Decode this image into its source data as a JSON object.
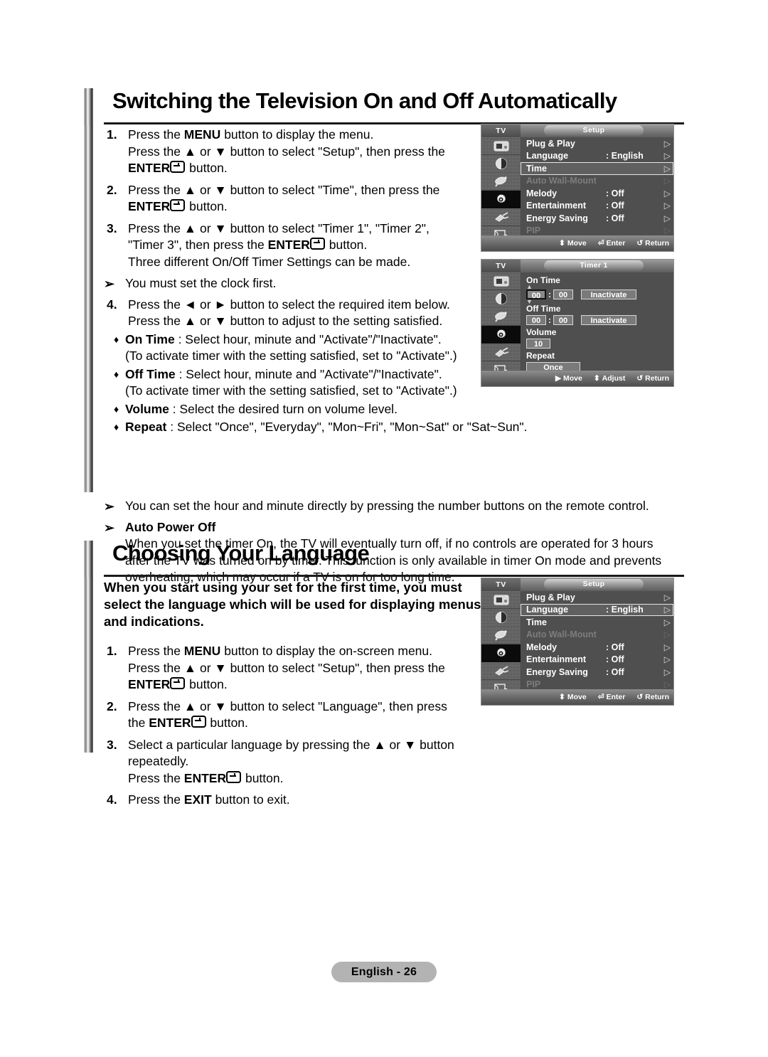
{
  "page": {
    "footer_badge": "English - 26",
    "background": "#ffffff"
  },
  "sections": [
    {
      "heading": "Switching the Television On and Off Automatically",
      "steps": [
        {
          "num": "1.",
          "lines": [
            [
              {
                "t": "Press the "
              },
              {
                "t": "MENU",
                "b": true
              },
              {
                "t": " button to display the menu."
              }
            ],
            [
              {
                "t": "Press the ▲ or ▼ button to select \"Setup\", then press the"
              }
            ],
            [
              {
                "t": "ENTER",
                "b": true
              },
              {
                "icon": "enter-return-icon"
              },
              {
                "t": " button."
              }
            ]
          ]
        },
        {
          "num": "2.",
          "lines": [
            [
              {
                "t": "Press the ▲ or ▼ button to select \"Time\", then press the"
              }
            ],
            [
              {
                "t": "ENTER",
                "b": true
              },
              {
                "icon": "enter-return-icon"
              },
              {
                "t": " button."
              }
            ]
          ]
        },
        {
          "num": "3.",
          "lines": [
            [
              {
                "t": "Press the ▲ or ▼ button to select \"Timer 1\", \"Timer 2\","
              }
            ],
            [
              {
                "t": "\"Timer 3\", then press the "
              },
              {
                "t": "ENTER",
                "b": true
              },
              {
                "icon": "enter-return-icon"
              },
              {
                "t": " button."
              }
            ],
            [
              {
                "t": "Three different On/Off Timer Settings can be made."
              }
            ]
          ]
        }
      ],
      "note_clock": "You must set the clock first.",
      "step4": {
        "num": "4.",
        "lines": [
          [
            {
              "t": "Press the ◄ or ► button to select the required item below."
            }
          ],
          [
            {
              "t": "Press the ▲ or ▼ button to adjust to the setting satisfied."
            }
          ]
        ]
      },
      "bullets": [
        {
          "term": "On Time",
          "rest": " : Select hour, minute and \"Activate\"/\"Inactivate\".",
          "sub": "(To activate timer with the setting satisfied, set to \"Activate\".)"
        },
        {
          "term": "Off Time",
          "rest": " : Select hour, minute and \"Activate\"/\"Inactivate\".",
          "sub": "(To activate timer with the setting satisfied, set to \"Activate\".)"
        },
        {
          "term": "Volume",
          "rest": " : Select the desired turn on volume level.",
          "sub": ""
        },
        {
          "term": "Repeat",
          "rest": " : Select \"Once\", \"Everyday\", \"Mon~Fri\", \"Mon~Sat\" or \"Sat~Sun\".",
          "sub": ""
        }
      ],
      "note_direct": "You can set the hour and minute directly by pressing the number buttons on the remote control.",
      "auto_power": {
        "title": "Auto Power Off",
        "lines": [
          "When you set the timer On, the TV will eventually turn off, if no controls are operated for 3 hours",
          "after the TV was turned on by timer. This function is only available in timer On mode and prevents",
          "overheating, which may occur if a TV is on for too long time."
        ]
      }
    },
    {
      "heading": "Choosing Your Language",
      "intro_lines": [
        "When you start using your set for the first time, you must",
        "select the language which will be used for displaying menus",
        "and indications."
      ],
      "steps": [
        {
          "num": "1.",
          "lines": [
            [
              {
                "t": "Press the "
              },
              {
                "t": "MENU",
                "b": true
              },
              {
                "t": " button to display the on-screen menu."
              }
            ],
            [
              {
                "t": "Press the ▲ or ▼ button to select \"Setup\", then press the"
              }
            ],
            [
              {
                "t": "ENTER",
                "b": true
              },
              {
                "icon": "enter-return-icon"
              },
              {
                "t": " button."
              }
            ]
          ]
        },
        {
          "num": "2.",
          "lines": [
            [
              {
                "t": "Press the ▲ or ▼ button to select \"Language\", then press"
              }
            ],
            [
              {
                "t": "the "
              },
              {
                "t": "ENTER",
                "b": true
              },
              {
                "icon": "enter-return-icon"
              },
              {
                "t": " button."
              }
            ]
          ]
        },
        {
          "num": "3.",
          "lines": [
            [
              {
                "t": "Select a particular language by pressing the ▲ or ▼ button"
              }
            ],
            [
              {
                "t": "repeatedly."
              }
            ],
            [
              {
                "t": "Press the "
              },
              {
                "t": "ENTER",
                "b": true
              },
              {
                "icon": "enter-return-icon"
              },
              {
                "t": " button."
              }
            ]
          ]
        },
        {
          "num": "4.",
          "lines": [
            [
              {
                "t": "Press the "
              },
              {
                "t": "EXIT",
                "b": true
              },
              {
                "t": " button to exit."
              }
            ]
          ]
        }
      ]
    }
  ],
  "osd": {
    "tv_label": "TV",
    "rail_icons": [
      "picture-icon",
      "sound-icon",
      "channel-dish-icon",
      "setup-gear-icon",
      "input-plug-icon",
      "pc-setup-icon"
    ],
    "setup_time": {
      "title": "Setup",
      "rows": [
        {
          "label": "Plug & Play",
          "value": "",
          "state": "normal",
          "arrow": "▷"
        },
        {
          "label": "Language",
          "value": ": English",
          "state": "normal",
          "arrow": "▷"
        },
        {
          "label": "Time",
          "value": "",
          "state": "selected",
          "arrow": "▷"
        },
        {
          "label": "Auto Wall-Mount",
          "value": "",
          "state": "dim",
          "arrow": "▷"
        },
        {
          "label": "Melody",
          "value": ": Off",
          "state": "normal",
          "arrow": "▷"
        },
        {
          "label": "Entertainment",
          "value": ": Off",
          "state": "normal",
          "arrow": "▷"
        },
        {
          "label": "Energy Saving",
          "value": ": Off",
          "state": "normal",
          "arrow": "▷"
        },
        {
          "label": "PIP",
          "value": "",
          "state": "dim",
          "arrow": "▷"
        }
      ],
      "footer": [
        {
          "icon": "updown-arrows-icon",
          "label": "Move"
        },
        {
          "icon": "enter-return-icon",
          "label": "Enter"
        },
        {
          "icon": "return-arrow-icon",
          "label": "Return"
        }
      ]
    },
    "setup_language": {
      "title": "Setup",
      "rows": [
        {
          "label": "Plug & Play",
          "value": "",
          "state": "normal",
          "arrow": "▷"
        },
        {
          "label": "Language",
          "value": ": English",
          "state": "selected",
          "arrow": "▷"
        },
        {
          "label": "Time",
          "value": "",
          "state": "normal",
          "arrow": "▷"
        },
        {
          "label": "Auto Wall-Mount",
          "value": "",
          "state": "dim",
          "arrow": "▷"
        },
        {
          "label": "Melody",
          "value": ": Off",
          "state": "normal",
          "arrow": "▷"
        },
        {
          "label": "Entertainment",
          "value": ": Off",
          "state": "normal",
          "arrow": "▷"
        },
        {
          "label": "Energy Saving",
          "value": ": Off",
          "state": "normal",
          "arrow": "▷"
        },
        {
          "label": "PIP",
          "value": "",
          "state": "dim",
          "arrow": "▷"
        }
      ],
      "footer": [
        {
          "icon": "updown-arrows-icon",
          "label": "Move"
        },
        {
          "icon": "enter-return-icon",
          "label": "Enter"
        },
        {
          "icon": "return-arrow-icon",
          "label": "Return"
        }
      ]
    },
    "timer1": {
      "title": "Timer 1",
      "on_time": {
        "label": "On Time",
        "hour": "00",
        "minute": "00",
        "activation": "Inactivate"
      },
      "off_time": {
        "label": "Off Time",
        "hour": "00",
        "minute": "00",
        "activation": "Inactivate"
      },
      "volume": {
        "label": "Volume",
        "value": "10"
      },
      "repeat": {
        "label": "Repeat",
        "value": "Once"
      },
      "footer": [
        {
          "icon": "right-arrow-icon",
          "label": "Move"
        },
        {
          "icon": "updown-arrows-icon",
          "label": "Adjust"
        },
        {
          "icon": "return-arrow-icon",
          "label": "Return"
        }
      ]
    }
  }
}
